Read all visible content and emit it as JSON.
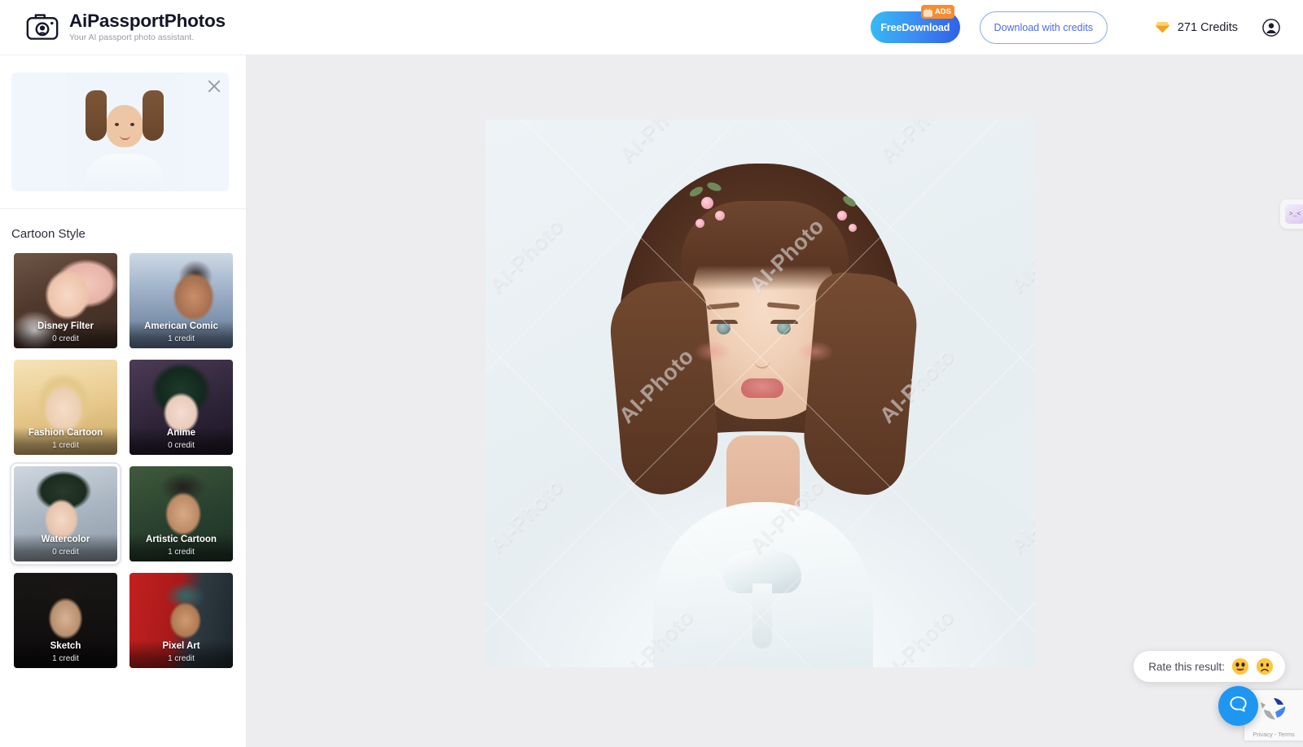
{
  "header": {
    "brand_title": "AiPassportPhotos",
    "brand_tagline": "Your AI passport photo assistant.",
    "brand_icon": "camera-icon",
    "free_download_label": "FreeDownload",
    "ads_badge_label": "ADS",
    "ads_badge_icon": "tv-icon",
    "download_credits_label": "Download with credits",
    "credits_icon": "gem-icon",
    "credits_label": "271 Credits",
    "credits_count": 271,
    "avatar_icon": "user-avatar-icon",
    "accent_blue": "#3d8bf2",
    "accent_orange": "#f98c2e",
    "link_blue": "#4a6cf0"
  },
  "sidebar": {
    "upload": {
      "close_icon": "close-icon",
      "photo_alt": "uploaded-portrait-thumbnail"
    },
    "section_title": "Cartoon Style",
    "styles": [
      {
        "name": "Disney Filter",
        "credit": "0 credit",
        "selected": false,
        "thumb": "t-disney"
      },
      {
        "name": "American Comic",
        "credit": "1 credit",
        "selected": false,
        "thumb": "t-comic"
      },
      {
        "name": "Fashion Cartoon",
        "credit": "1 credit",
        "selected": false,
        "thumb": "t-fashion"
      },
      {
        "name": "Anime",
        "credit": "0 credit",
        "selected": false,
        "thumb": "t-anime"
      },
      {
        "name": "Watercolor",
        "credit": "0 credit",
        "selected": true,
        "thumb": "t-water"
      },
      {
        "name": "Artistic Cartoon",
        "credit": "1 credit",
        "selected": false,
        "thumb": "t-artistic"
      },
      {
        "name": "Sketch",
        "credit": "1 credit",
        "selected": false,
        "thumb": "t-sketch"
      },
      {
        "name": "Pixel Art",
        "credit": "1 credit",
        "selected": false,
        "thumb": "t-pixel"
      }
    ]
  },
  "main": {
    "result_alt": "generated-watercolor-portrait",
    "watermark_text": "AI-Photo",
    "mini_widget_glyph": ">_<",
    "canvas_bg": "#ededef"
  },
  "footer": {
    "rate_label": "Rate this result:",
    "rate_happy_icon": "happy-face-emoji",
    "rate_sad_icon": "sad-face-emoji",
    "help_icon": "chat-bubble-icon",
    "recaptcha_terms": "Privacy - Terms",
    "help_bg": "#1e97f3"
  }
}
